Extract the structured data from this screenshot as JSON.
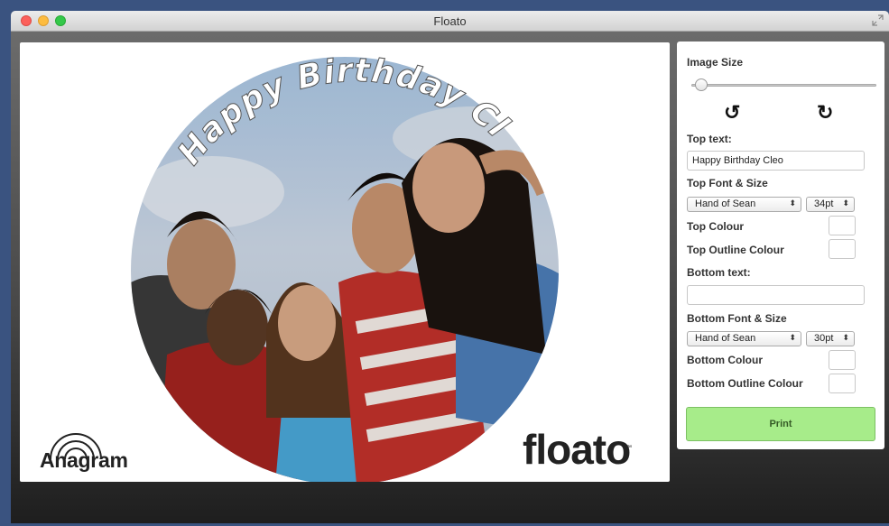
{
  "window": {
    "title": "Floato"
  },
  "canvas": {
    "top_text": "Happy Birthday Cleo",
    "logo_left": "Anagram",
    "logo_right": "floato",
    "trademark": "™"
  },
  "panel": {
    "image_size_label": "Image Size",
    "image_size_value": 0.02,
    "rotate_left_icon": "↺",
    "rotate_right_icon": "↻",
    "top_text_label": "Top text:",
    "top_text_value": "Happy Birthday Cleo",
    "top_font_label": "Top Font & Size",
    "top_font": "Hand of Sean",
    "top_size": "34pt",
    "top_colour_label": "Top Colour",
    "top_outline_label": "Top Outline Colour",
    "bottom_text_label": "Bottom text:",
    "bottom_text_value": "",
    "bottom_font_label": "Bottom Font & Size",
    "bottom_font": "Hand of Sean",
    "bottom_size": "30pt",
    "bottom_colour_label": "Bottom Colour",
    "bottom_outline_label": "Bottom Outline Colour",
    "print_label": "Print",
    "select_arrow": "⬍"
  },
  "colors": {
    "print_button": "#a7ec8a",
    "desktop": "#3a5380"
  }
}
